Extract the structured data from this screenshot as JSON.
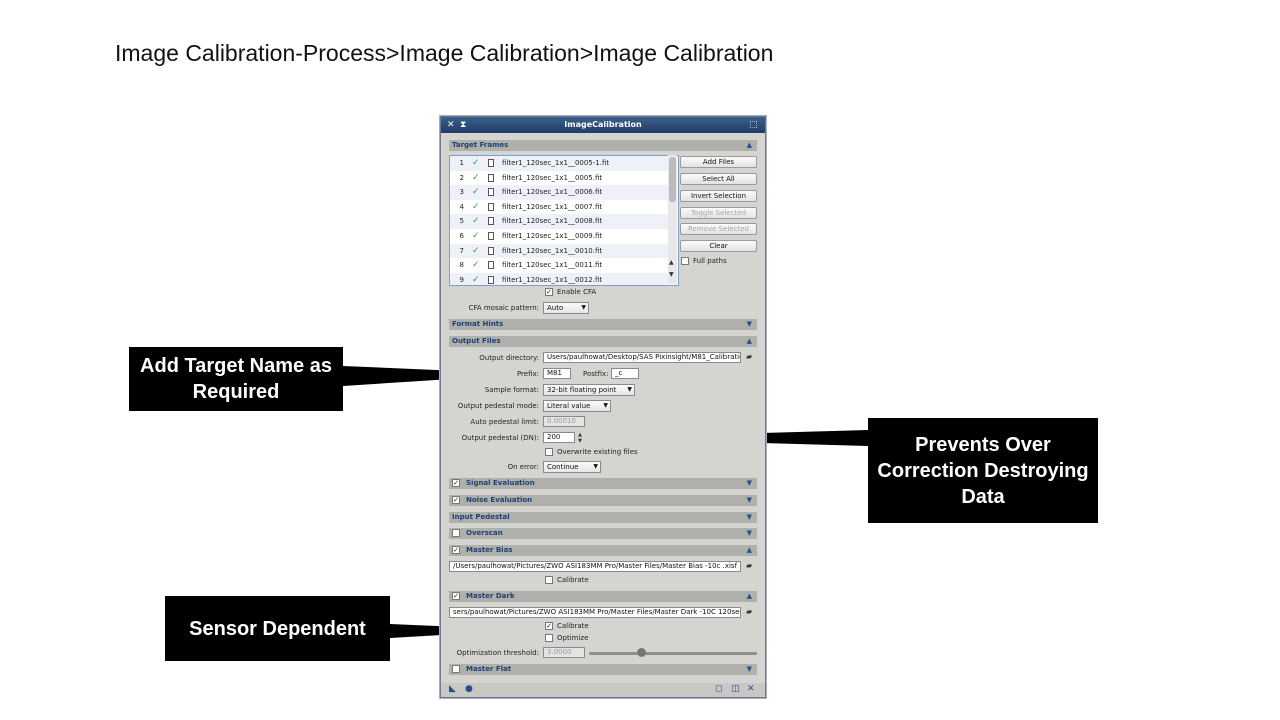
{
  "slide": {
    "title": "Image Calibration-Process>Image Calibration>Image Calibration"
  },
  "window": {
    "title": "ImageCalibration",
    "sections": {
      "target_frames": "Target Frames",
      "format_hints": "Format Hints",
      "output_files": "Output Files",
      "signal_evaluation": "Signal Evaluation",
      "noise_evaluation": "Noise Evaluation",
      "input_pedestal": "Input Pedestal",
      "overscan": "Overscan",
      "master_bias": "Master Bias",
      "master_dark": "Master Dark",
      "master_flat": "Master Flat"
    },
    "target_frames": {
      "files": [
        {
          "n": "1",
          "name": "filter1_120sec_1x1__0005-1.fit"
        },
        {
          "n": "2",
          "name": "filter1_120sec_1x1__0005.fit"
        },
        {
          "n": "3",
          "name": "filter1_120sec_1x1__0006.fit"
        },
        {
          "n": "4",
          "name": "filter1_120sec_1x1__0007.fit"
        },
        {
          "n": "5",
          "name": "filter1_120sec_1x1__0008.fit"
        },
        {
          "n": "6",
          "name": "filter1_120sec_1x1__0009.fit"
        },
        {
          "n": "7",
          "name": "filter1_120sec_1x1__0010.fit"
        },
        {
          "n": "8",
          "name": "filter1_120sec_1x1__0011.fit"
        },
        {
          "n": "9",
          "name": "filter1_120sec_1x1__0012.fit"
        }
      ],
      "buttons": {
        "add_files": "Add Files",
        "select_all": "Select All",
        "invert_selection": "Invert Selection",
        "toggle_selected": "Toggle Selected",
        "remove_selected": "Remove Selected",
        "clear": "Clear"
      },
      "full_paths": "Full paths",
      "enable_cfa": "Enable CFA",
      "cfa_label": "CFA mosaic pattern:",
      "cfa_value": "Auto"
    },
    "output_files": {
      "dir_label": "Output directory:",
      "dir_value": "Users/paulhowat/Desktop/SAS Pixinsight/M81_Calibration",
      "prefix_label": "Prefix:",
      "prefix_value": "M81",
      "postfix_label": "Postfix:",
      "postfix_value": "_c",
      "sample_label": "Sample format:",
      "sample_value": "32-bit floating point",
      "pedestal_mode_label": "Output pedestal mode:",
      "pedestal_mode_value": "Literal value",
      "auto_limit_label": "Auto pedestal limit:",
      "auto_limit_value": "0.00010",
      "pedestal_label": "Output pedestal (DN):",
      "pedestal_value": "200",
      "overwrite_label": "Overwrite existing files",
      "on_error_label": "On error:",
      "on_error_value": "Continue"
    },
    "master_bias": {
      "path": "/Users/paulhowat/Pictures/ZWO ASI183MM Pro/Master Files/Master Bias -10c .xisf",
      "calibrate": "Calibrate"
    },
    "master_dark": {
      "path": "sers/paulhowat/Pictures/ZWO ASI183MM Pro/Master Files/Master Dark -10C 120sec.xisf",
      "calibrate": "Calibrate",
      "optimize": "Optimize",
      "threshold_label": "Optimization threshold:",
      "threshold_value": "3.0000"
    }
  },
  "callouts": {
    "target_name": "Add Target Name as Required",
    "pedestal": "Prevents Over Correction Destroying Data",
    "sensor": "Sensor Dependent"
  }
}
